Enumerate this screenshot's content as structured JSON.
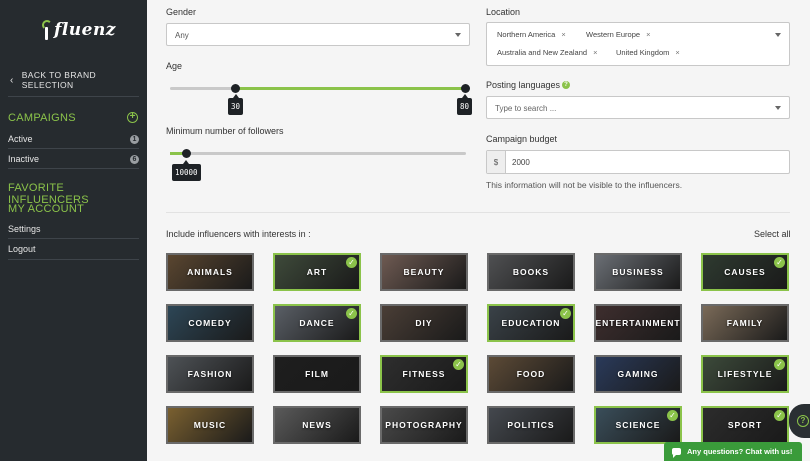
{
  "brand": {
    "logo_text": "fluenz"
  },
  "sidebar": {
    "back_label": "BACK TO BRAND SELECTION",
    "campaigns_heading": "CAMPAIGNS",
    "campaign_items": [
      {
        "label": "Active",
        "count": "1"
      },
      {
        "label": "Inactive",
        "count": "6"
      }
    ],
    "favorites_heading": "FAVORITE INFLUENCERS",
    "account_heading": "MY ACCOUNT",
    "account_items": [
      {
        "label": "Settings"
      },
      {
        "label": "Logout"
      }
    ]
  },
  "form": {
    "gender": {
      "label": "Gender",
      "value": "Any"
    },
    "age": {
      "label": "Age",
      "min_value": "30",
      "max_value": "80"
    },
    "followers": {
      "label": "Minimum number of followers",
      "value": "10000"
    },
    "location": {
      "label": "Location",
      "chips": [
        "Northern America",
        "Western Europe",
        "Australia and New Zealand",
        "United Kingdom"
      ],
      "remove_glyph": "×"
    },
    "languages": {
      "label": "Posting languages",
      "placeholder": "Type to search ..."
    },
    "budget": {
      "label": "Campaign budget",
      "currency": "$",
      "value": "2000",
      "hint": "This information will not be visible to the influencers."
    }
  },
  "interests": {
    "heading": "Include influencers with interests in :",
    "select_all": "Select all",
    "tiles": [
      {
        "label": "ANIMALS",
        "selected": false,
        "bg": "#5a4630"
      },
      {
        "label": "ART",
        "selected": true,
        "bg": "#3e4a3a"
      },
      {
        "label": "BEAUTY",
        "selected": false,
        "bg": "#6e5a52"
      },
      {
        "label": "BOOKS",
        "selected": false,
        "bg": "#4f5052"
      },
      {
        "label": "BUSINESS",
        "selected": false,
        "bg": "#6a6e74"
      },
      {
        "label": "CAUSES",
        "selected": true,
        "bg": "#2e3a30"
      },
      {
        "label": "COMEDY",
        "selected": false,
        "bg": "#2d4656"
      },
      {
        "label": "DANCE",
        "selected": true,
        "bg": "#5a5f66"
      },
      {
        "label": "DIY",
        "selected": false,
        "bg": "#4a3e36"
      },
      {
        "label": "EDUCATION",
        "selected": true,
        "bg": "#3a4248"
      },
      {
        "label": "ENTERTAINMENT",
        "selected": false,
        "bg": "#3e2e2e"
      },
      {
        "label": "FAMILY",
        "selected": false,
        "bg": "#7a6a58"
      },
      {
        "label": "FASHION",
        "selected": false,
        "bg": "#4e5256"
      },
      {
        "label": "FILM",
        "selected": false,
        "bg": "#1e1e1e"
      },
      {
        "label": "FITNESS",
        "selected": true,
        "bg": "#2e2e2e"
      },
      {
        "label": "FOOD",
        "selected": false,
        "bg": "#5c4a36"
      },
      {
        "label": "GAMING",
        "selected": false,
        "bg": "#2a3a5a"
      },
      {
        "label": "LIFESTYLE",
        "selected": true,
        "bg": "#3c4a3a"
      },
      {
        "label": "MUSIC",
        "selected": false,
        "bg": "#7a6030"
      },
      {
        "label": "NEWS",
        "selected": false,
        "bg": "#5a5a5a"
      },
      {
        "label": "PHOTOGRAPHY",
        "selected": false,
        "bg": "#4a4a4a"
      },
      {
        "label": "POLITICS",
        "selected": false,
        "bg": "#44484e"
      },
      {
        "label": "SCIENCE",
        "selected": true,
        "bg": "#3a4e5a"
      },
      {
        "label": "SPORT",
        "selected": true,
        "bg": "#2c2c2c"
      }
    ]
  },
  "chat": {
    "label": "Any questions? Chat with us!"
  },
  "colors": {
    "accent": "#8bc34a",
    "sidebar": "#262b2f",
    "chat": "#3a9b3a"
  }
}
